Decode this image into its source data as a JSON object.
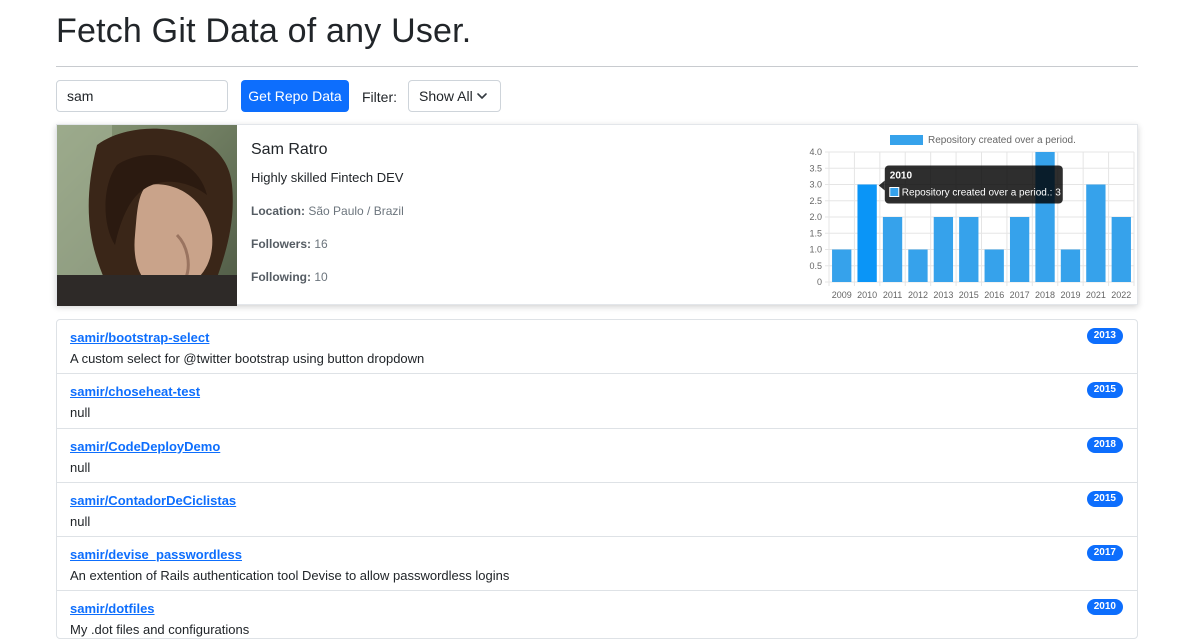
{
  "header": {
    "title": "Fetch Git Data of any User."
  },
  "search": {
    "value": "sam",
    "button_label": "Get Repo Data"
  },
  "filter": {
    "label": "Filter:",
    "selected": "Show All"
  },
  "profile": {
    "name": "Sam Ratro",
    "bio": "Highly skilled Fintech DEV",
    "location_label": "Location:",
    "location": "São Paulo / Brazil",
    "followers_label": "Followers:",
    "followers": "16",
    "following_label": "Following:",
    "following": "10"
  },
  "chart_data": {
    "type": "bar",
    "legend_label": "Repository created over a period.",
    "legend_placement": "top",
    "categories": [
      "2009",
      "2010",
      "2011",
      "2012",
      "2013",
      "2015",
      "2016",
      "2017",
      "2018",
      "2019",
      "2021",
      "2022"
    ],
    "series": [
      {
        "name": "Repository created over a period.",
        "values": [
          1,
          3,
          2,
          1,
          2,
          2,
          1,
          2,
          4,
          1,
          3,
          2
        ]
      }
    ],
    "ylim": [
      0,
      4
    ],
    "yticks": [
      "4.0",
      "3.5",
      "3.0",
      "2.5",
      "2.0",
      "1.5",
      "1.0",
      "0.5",
      "0"
    ],
    "grid": true,
    "bar_color": "#36a2eb",
    "highlight_color": "#0a95f7",
    "tooltip": {
      "title": "2010",
      "label": "Repository created over a period.: 3",
      "category_index": 1
    }
  },
  "repos": [
    {
      "name": "samir/bootstrap-select",
      "description": "A custom select for @twitter bootstrap using button dropdown",
      "year": "2013"
    },
    {
      "name": "samir/choseheat-test",
      "description": "null",
      "year": "2015"
    },
    {
      "name": "samir/CodeDeployDemo",
      "description": "null",
      "year": "2018"
    },
    {
      "name": "samir/ContadorDeCiclistas",
      "description": "null",
      "year": "2015"
    },
    {
      "name": "samir/devise_passwordless",
      "description": "An extention of Rails authentication tool Devise to allow passwordless logins",
      "year": "2017"
    },
    {
      "name": "samir/dotfiles",
      "description": "My .dot files and configurations",
      "year": "2010"
    }
  ],
  "colors": {
    "accent": "#0d6efd",
    "chart_bar": "#36a2eb"
  }
}
